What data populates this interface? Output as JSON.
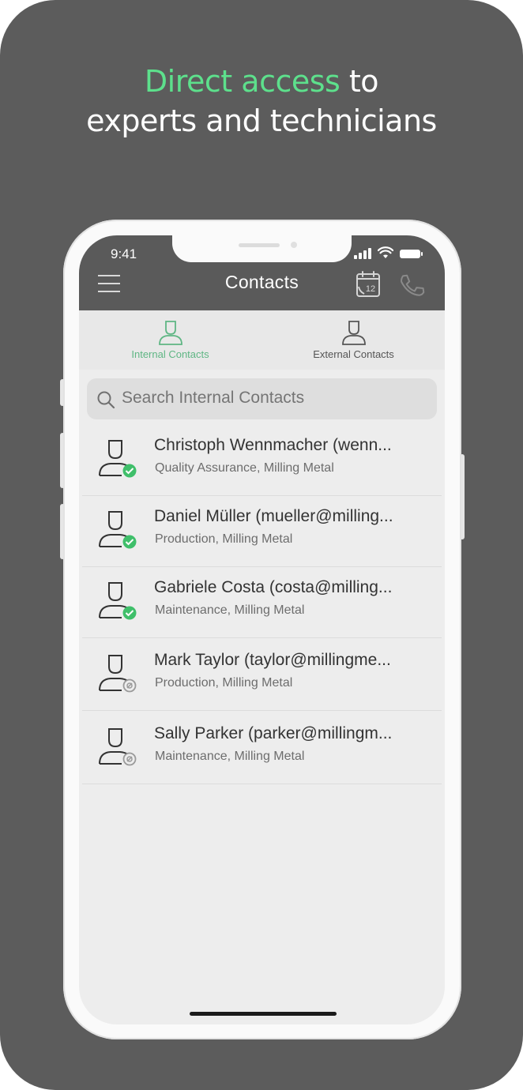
{
  "headline": {
    "green": "Direct access",
    "rest_line1": " to",
    "line2": "experts and technicians"
  },
  "status_bar": {
    "time": "9:41"
  },
  "app_bar": {
    "title": "Contacts",
    "calendar_day": "12"
  },
  "tabs": [
    {
      "label": "Internal Contacts",
      "active": true
    },
    {
      "label": "External Contacts",
      "active": false
    }
  ],
  "search": {
    "placeholder": "Search Internal Contacts"
  },
  "contacts": [
    {
      "name": "Christoph Wennmacher (wenn...",
      "subtitle": "Quality Assurance, Milling Metal",
      "status": "online"
    },
    {
      "name": "Daniel Müller (mueller@milling...",
      "subtitle": "Production, Milling Metal",
      "status": "online"
    },
    {
      "name": "Gabriele Costa (costa@milling...",
      "subtitle": "Maintenance, Milling Metal",
      "status": "online"
    },
    {
      "name": "Mark Taylor (taylor@millingme...",
      "subtitle": "Production, Milling Metal",
      "status": "offline"
    },
    {
      "name": "Sally Parker (parker@millingm...",
      "subtitle": "Maintenance, Milling Metal",
      "status": "offline"
    }
  ],
  "colors": {
    "accent_green": "#5de08c",
    "tab_active": "#5fb684",
    "status_online": "#3fbf6a",
    "status_offline": "#9a9a9a",
    "app_bar": "#5a5a5a",
    "background": "#5c5c5c"
  }
}
